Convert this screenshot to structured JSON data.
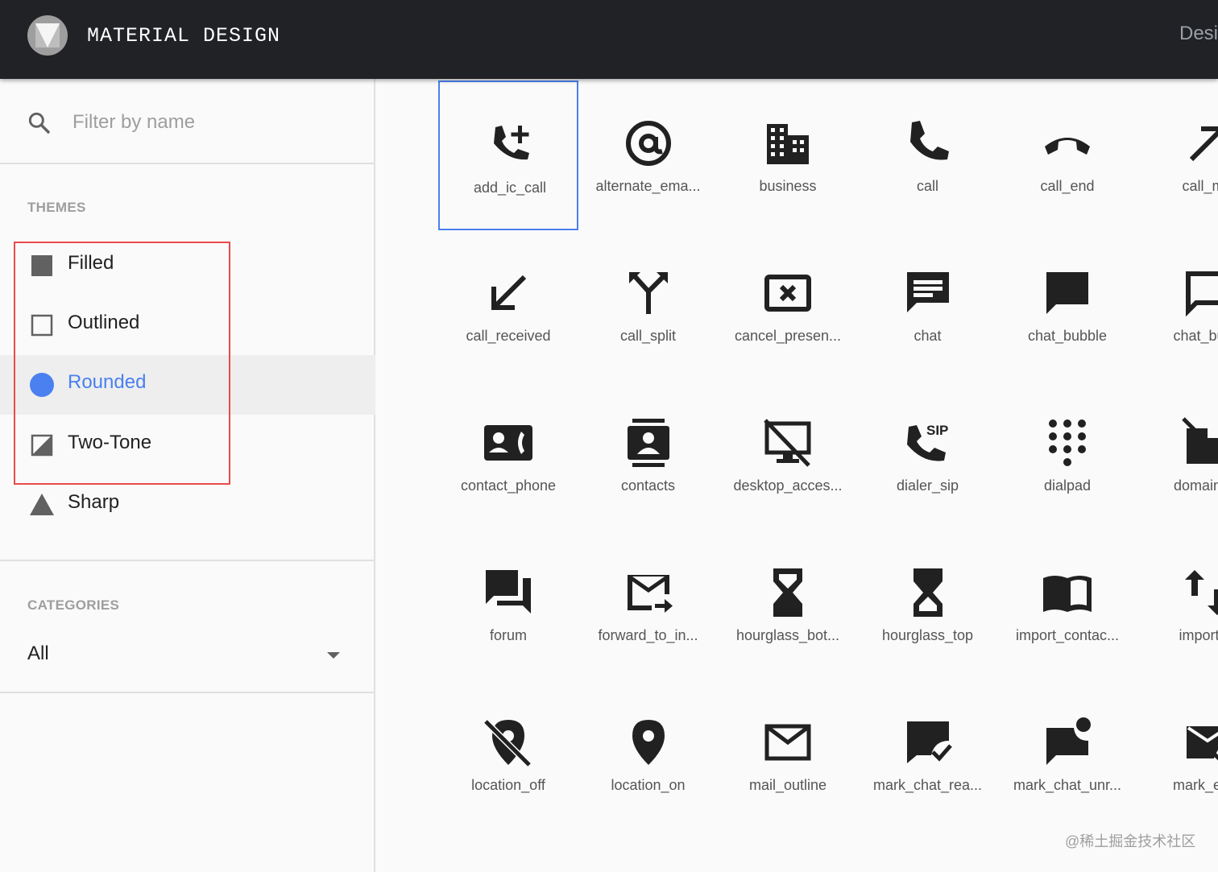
{
  "header": {
    "brand": "MATERIAL DESIGN",
    "right_link": "Desi"
  },
  "search": {
    "placeholder": "Filter by name",
    "icon": "search-icon"
  },
  "themes": {
    "title": "THEMES",
    "items": [
      {
        "label": "Filled",
        "icon": "filled-square-icon",
        "active": false
      },
      {
        "label": "Outlined",
        "icon": "outlined-square-icon",
        "active": false
      },
      {
        "label": "Rounded",
        "icon": "rounded-circle-icon",
        "active": true
      },
      {
        "label": "Two-Tone",
        "icon": "two-tone-square-icon",
        "active": false
      },
      {
        "label": "Sharp",
        "icon": "sharp-triangle-icon",
        "active": false
      }
    ]
  },
  "categories": {
    "title": "CATEGORIES",
    "value": "All"
  },
  "icons": [
    {
      "label": "add_ic_call",
      "icon": "add-ic-call-icon",
      "selected": true
    },
    {
      "label": "alternate_ema...",
      "icon": "alternate-email-icon"
    },
    {
      "label": "business",
      "icon": "business-icon"
    },
    {
      "label": "call",
      "icon": "call-icon"
    },
    {
      "label": "call_end",
      "icon": "call-end-icon"
    },
    {
      "label": "call_ma",
      "icon": "call-made-icon"
    },
    {
      "label": "call_received",
      "icon": "call-received-icon"
    },
    {
      "label": "call_split",
      "icon": "call-split-icon"
    },
    {
      "label": "cancel_presen...",
      "icon": "cancel-presentation-icon"
    },
    {
      "label": "chat",
      "icon": "chat-icon"
    },
    {
      "label": "chat_bubble",
      "icon": "chat-bubble-icon"
    },
    {
      "label": "chat_bubb",
      "icon": "chat-bubble-outline-icon"
    },
    {
      "label": "contact_phone",
      "icon": "contact-phone-icon"
    },
    {
      "label": "contacts",
      "icon": "contacts-icon"
    },
    {
      "label": "desktop_acces...",
      "icon": "desktop-access-disabled-icon"
    },
    {
      "label": "dialer_sip",
      "icon": "dialer-sip-icon"
    },
    {
      "label": "dialpad",
      "icon": "dialpad-icon"
    },
    {
      "label": "domain_di",
      "icon": "domain-disabled-icon"
    },
    {
      "label": "forum",
      "icon": "forum-icon"
    },
    {
      "label": "forward_to_in...",
      "icon": "forward-to-inbox-icon"
    },
    {
      "label": "hourglass_bot...",
      "icon": "hourglass-bottom-icon"
    },
    {
      "label": "hourglass_top",
      "icon": "hourglass-top-icon"
    },
    {
      "label": "import_contac...",
      "icon": "import-contacts-icon"
    },
    {
      "label": "import_e",
      "icon": "import-export-icon"
    },
    {
      "label": "location_off",
      "icon": "location-off-icon"
    },
    {
      "label": "location_on",
      "icon": "location-on-icon"
    },
    {
      "label": "mail_outline",
      "icon": "mail-outline-icon"
    },
    {
      "label": "mark_chat_rea...",
      "icon": "mark-chat-read-icon"
    },
    {
      "label": "mark_chat_unr...",
      "icon": "mark-chat-unread-icon"
    },
    {
      "label": "mark_ema",
      "icon": "mark-email-read-icon"
    }
  ],
  "watermark": "@稀土掘金技术社区"
}
